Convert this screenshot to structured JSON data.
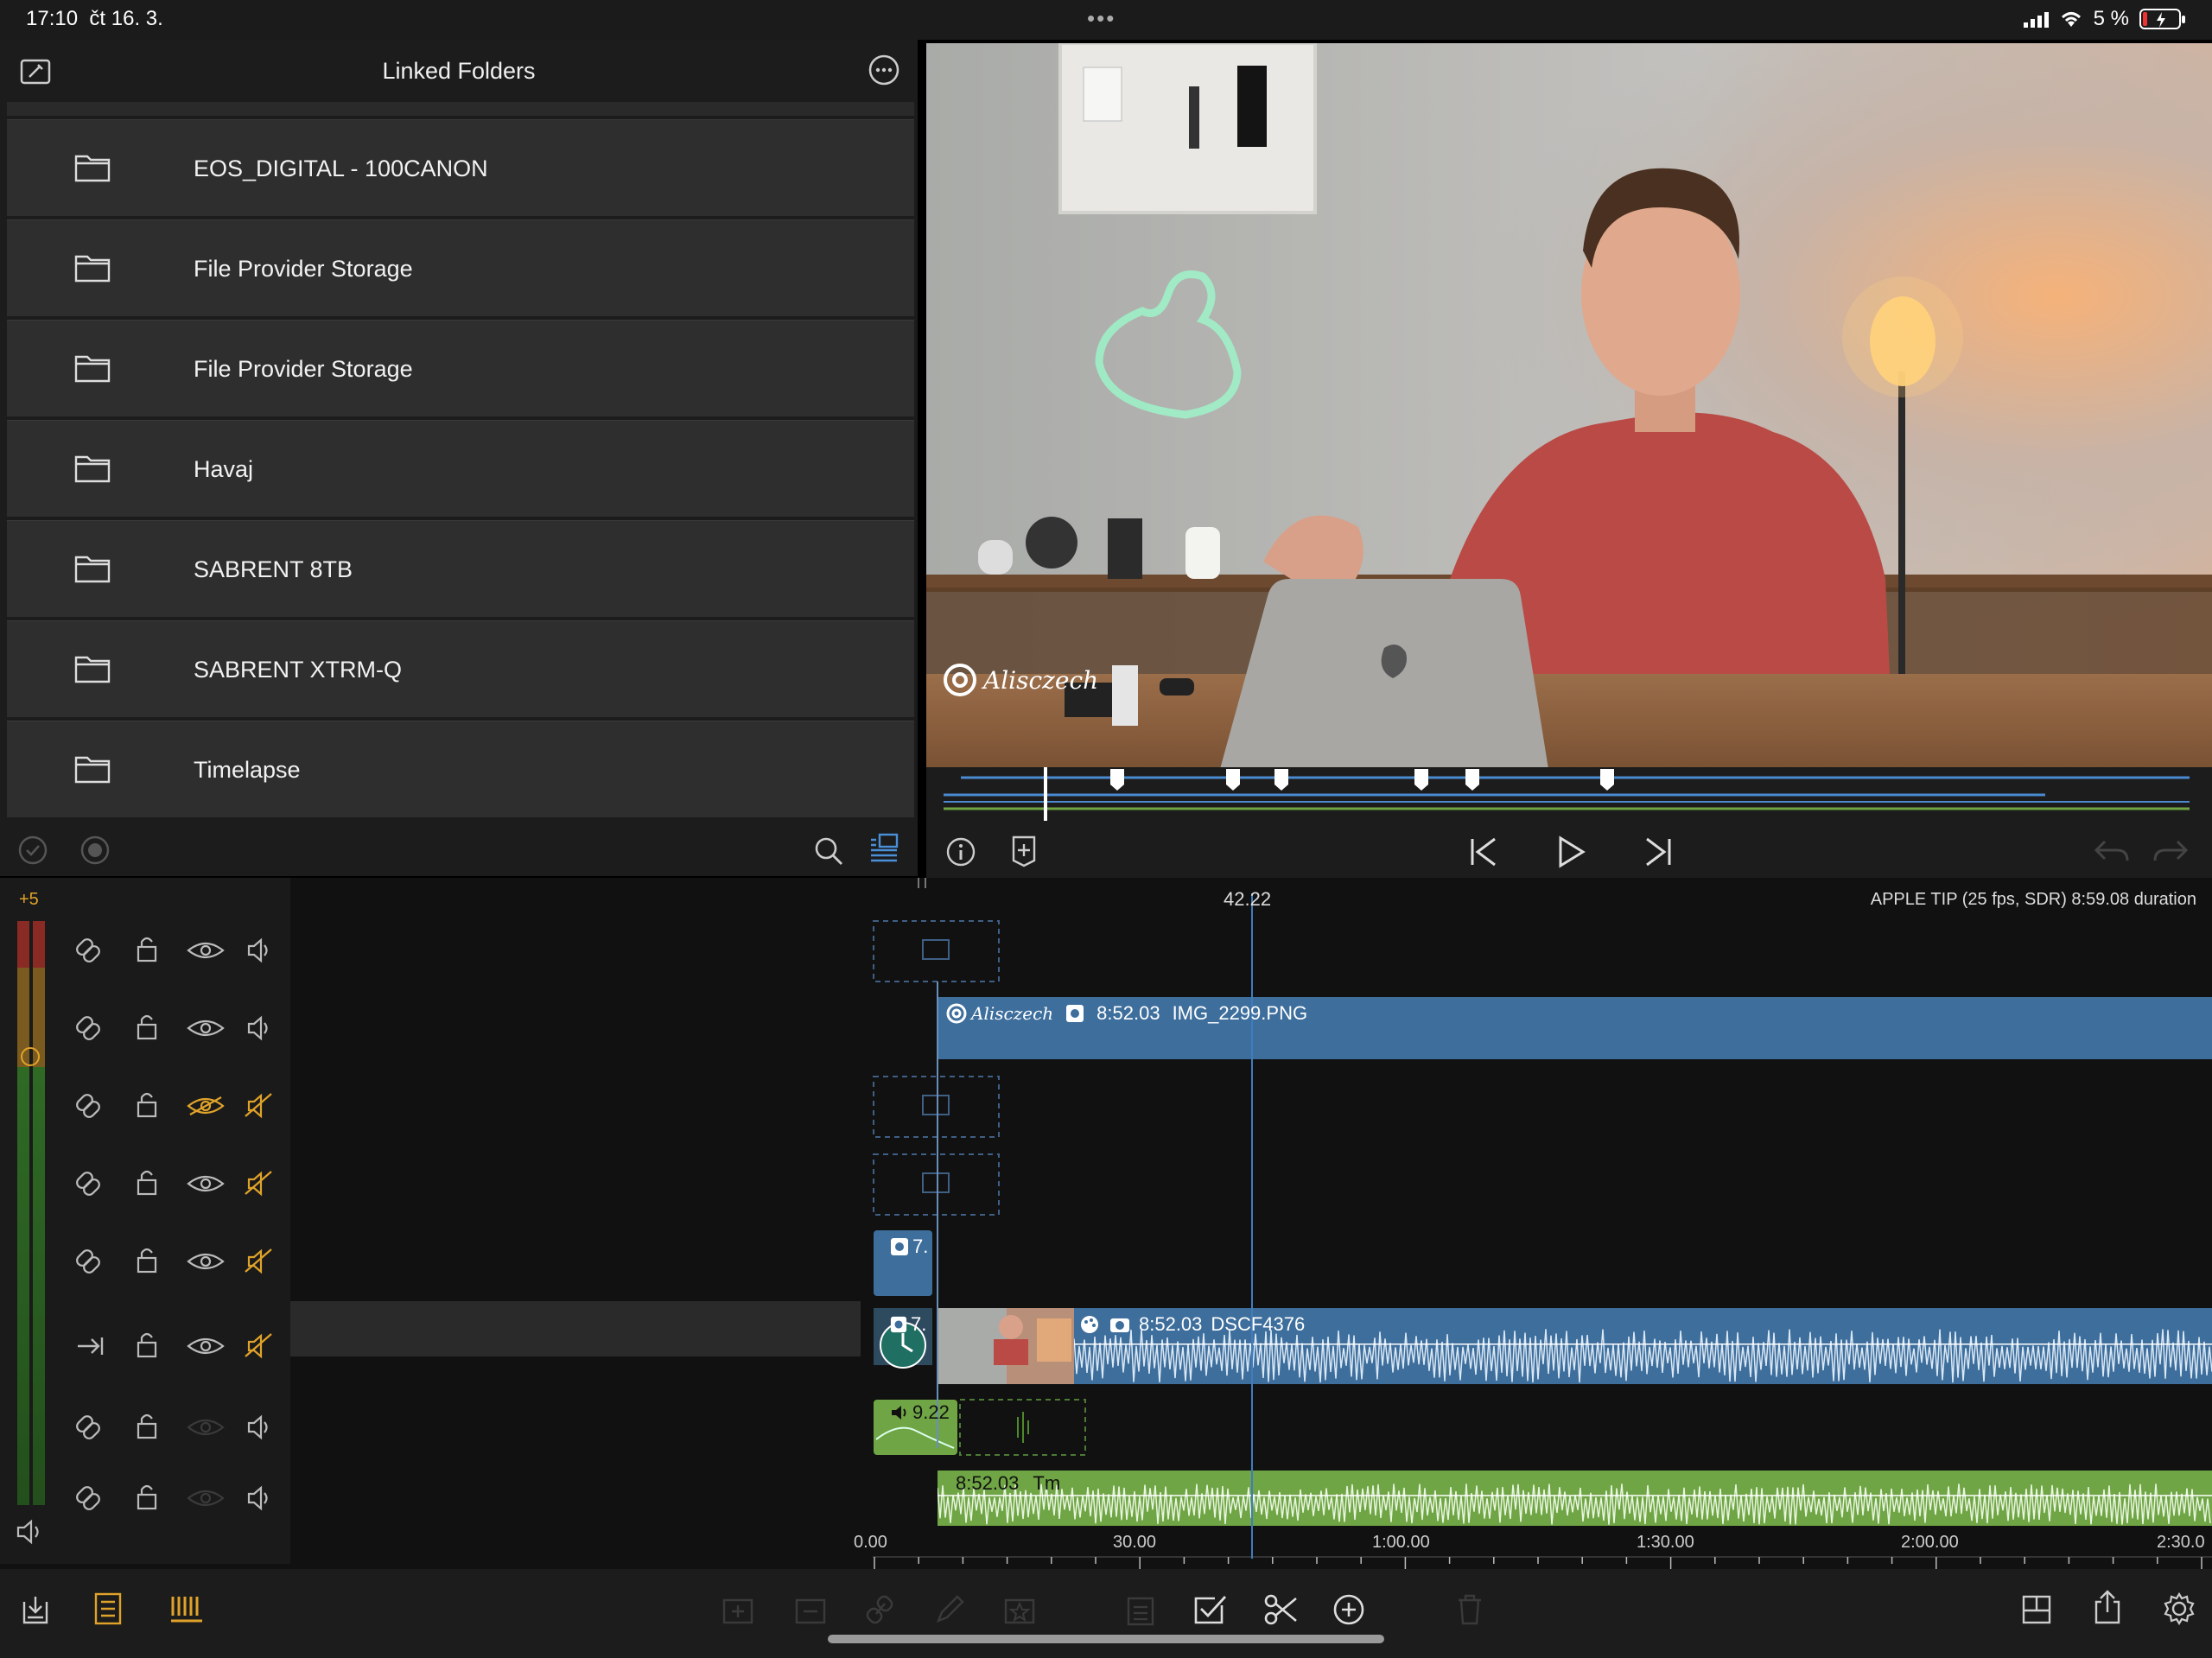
{
  "status_bar": {
    "time": "17:10",
    "date": "čt 16. 3.",
    "battery": "5 %"
  },
  "browser": {
    "title": "Linked Folders",
    "folders": [
      {
        "label": "EOS_DIGITAL - 100CANON"
      },
      {
        "label": "File Provider Storage"
      },
      {
        "label": "File Provider Storage"
      },
      {
        "label": "Havaj"
      },
      {
        "label": "SABRENT 8TB"
      },
      {
        "label": "SABRENT XTRM-Q"
      },
      {
        "label": "Timelapse"
      }
    ]
  },
  "viewer": {
    "watermark": "Alisczech"
  },
  "timeline": {
    "playhead_time": "42.22",
    "project_info": "APPLE TIP (25 fps, SDR)  8:59.08 duration",
    "meter_label": "+5",
    "clips": {
      "image_clip_duration": "8:52.03",
      "image_clip_name": "IMG_2299.PNG",
      "image_clip_logo": "Alisczech",
      "small_clip_label": "7.",
      "video_clip_duration": "8:52.03",
      "video_clip_name": "DSCF4376",
      "video_clip_small": "7.",
      "audio_clip_small": "9.22",
      "music_clip_duration": "8:52.03",
      "music_clip_name": "Tm"
    },
    "ruler": [
      "0.00",
      "30.00",
      "1:00.00",
      "1:30.00",
      "2:00.00",
      "2:30.0"
    ]
  },
  "colors": {
    "accent_blue": "#3d6e9c",
    "audio_green": "#6fa544",
    "toggle_yellow": "#e0a32a"
  }
}
